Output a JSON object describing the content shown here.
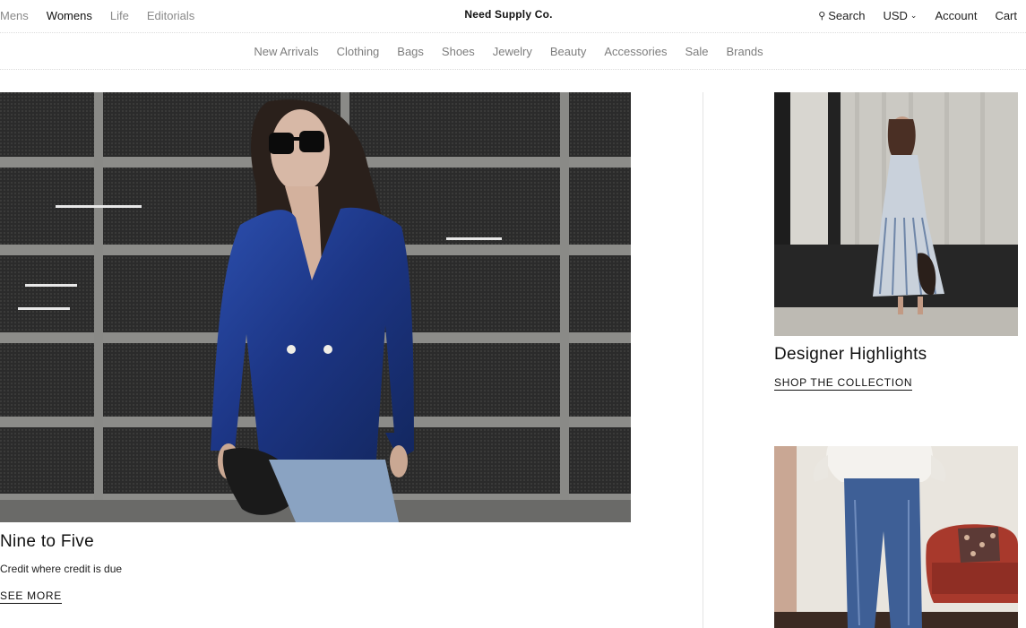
{
  "header": {
    "left_nav": [
      "Mens",
      "Womens",
      "Life",
      "Editorials"
    ],
    "active_left": "Womens",
    "brand": "Need Supply Co.",
    "search_label": "Search",
    "currency": "USD",
    "account_label": "Account",
    "cart_label": "Cart"
  },
  "categories": [
    "New Arrivals",
    "Clothing",
    "Bags",
    "Shoes",
    "Jewelry",
    "Beauty",
    "Accessories",
    "Sale",
    "Brands"
  ],
  "hero": {
    "title": "Nine to Five",
    "subtitle": "Credit where credit is due",
    "link": "SEE MORE"
  },
  "feature": {
    "title": "Designer Highlights",
    "link": "SHOP THE COLLECTION"
  },
  "icons": {
    "search": "search-icon",
    "currency_dropdown": "chevron-down-icon"
  },
  "colors": {
    "muted_text": "#8a8a8a",
    "blazer_blue": "#1f3c8f",
    "sofa_red": "#a8392c"
  }
}
